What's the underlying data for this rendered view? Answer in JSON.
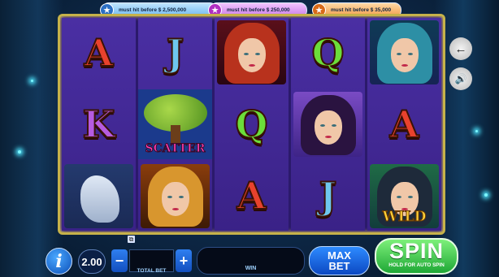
{
  "jackpots": [
    {
      "text": "must hit before $ 2,500,000",
      "star": "★",
      "color": "#2b6fc4"
    },
    {
      "text": "must hit before $ 250,000",
      "star": "★",
      "color": "#b02fc2"
    },
    {
      "text": "must hit before $ 35,000",
      "star": "★",
      "color": "#d86a18"
    }
  ],
  "reels": [
    [
      {
        "type": "letter",
        "value": "A"
      },
      {
        "type": "letter",
        "value": "K"
      },
      {
        "type": "unicorn",
        "icon": "unicorn-symbol"
      }
    ],
    [
      {
        "type": "letter",
        "value": "J"
      },
      {
        "type": "scatter",
        "label": "SCATTER"
      },
      {
        "type": "portrait",
        "style": "blonde"
      }
    ],
    [
      {
        "type": "portrait",
        "style": "red"
      },
      {
        "type": "letter",
        "value": "Q"
      },
      {
        "type": "letter",
        "value": "A"
      }
    ],
    [
      {
        "type": "letter",
        "value": "Q"
      },
      {
        "type": "portrait",
        "style": "purple"
      },
      {
        "type": "letter",
        "value": "J"
      }
    ],
    [
      {
        "type": "portrait",
        "style": "teal"
      },
      {
        "type": "letter",
        "value": "A"
      },
      {
        "type": "wild",
        "label": "WILD"
      }
    ]
  ],
  "side_buttons": {
    "back_icon": "←",
    "sound_icon": "🔊"
  },
  "controls": {
    "info_label": "i",
    "coin_value": "2.00",
    "minus_label": "−",
    "plus_label": "+",
    "total_bet_label": "TOTAL BET",
    "win_label": "WIN",
    "max_bet_line1": "MAX",
    "max_bet_line2": "BET",
    "spin_label": "SPIN",
    "spin_sub_label": "HOLD FOR AUTO SPIN"
  },
  "colors": {
    "frame": "#c6b24a",
    "reel_bg": "#3a2287",
    "spin_green": "#1fa836",
    "button_blue": "#0c48c2"
  }
}
